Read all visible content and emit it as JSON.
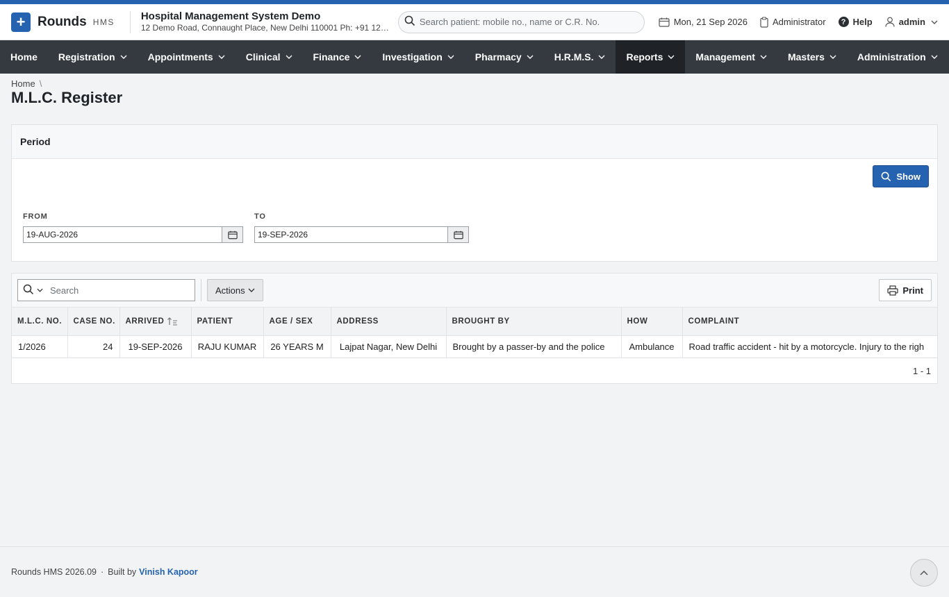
{
  "header": {
    "brand": "Rounds",
    "brand_suffix": "HMS",
    "hospital_name": "Hospital Management System Demo",
    "hospital_address": "12 Demo Road, Connaught Place, New Delhi 110001 Ph: +91 123...",
    "search_placeholder": "Search patient: mobile no., name or C.R. No.",
    "date": "Mon, 21 Sep 2026",
    "role": "Administrator",
    "help": "Help",
    "user": "admin"
  },
  "nav": {
    "items": [
      "Home",
      "Registration",
      "Appointments",
      "Clinical",
      "Finance",
      "Investigation",
      "Pharmacy",
      "H.R.M.S.",
      "Reports",
      "Management",
      "Masters",
      "Administration"
    ],
    "active": "Reports"
  },
  "breadcrumb": {
    "home": "Home",
    "separator": "\\"
  },
  "page": {
    "title": "M.L.C. Register"
  },
  "period": {
    "heading": "Period",
    "show_label": "Show",
    "from_label": "FROM",
    "from_value": "19-AUG-2026",
    "to_label": "TO",
    "to_value": "19-SEP-2026"
  },
  "report": {
    "search_placeholder": "Search",
    "actions_label": "Actions",
    "print_label": "Print",
    "columns": [
      "M.L.C. NO.",
      "CASE NO.",
      "ARRIVED",
      "PATIENT",
      "AGE / SEX",
      "ADDRESS",
      "BROUGHT BY",
      "HOW",
      "COMPLAINT"
    ],
    "rows": [
      {
        "mlc_no": "1/2026",
        "case_no": "24",
        "arrived": "19-SEP-2026",
        "patient": "RAJU KUMAR",
        "age_sex": "26 YEARS M",
        "address": "Lajpat Nagar, New Delhi",
        "brought_by": "Brought by a passer-by and the police",
        "how": "Ambulance",
        "complaint": "Road traffic accident - hit by a motorcycle. Injury to the righ"
      }
    ],
    "pagination": "1 - 1"
  },
  "footer": {
    "version": "Rounds HMS 2026.09",
    "dot": "·",
    "built_by": "Built by",
    "author": "Vinish Kapoor"
  },
  "colors": {
    "accent": "#2563b0",
    "nav_bg": "#343a40",
    "nav_active": "#1f2327"
  }
}
